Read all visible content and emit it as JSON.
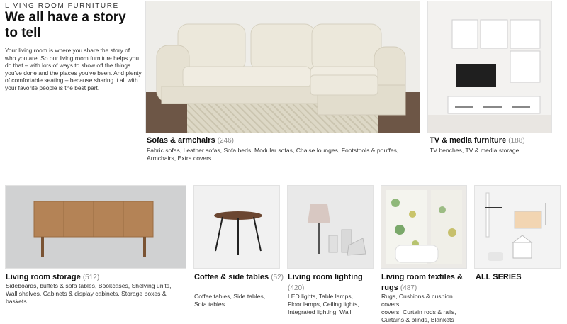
{
  "header": {
    "eyebrow": "LIVING ROOM FURNITURE",
    "headline": "We all have a story to tell",
    "intro": "Your living room is where you share the story of who you are. So our living room furniture helps you do that – with lots of ways to show off the things you've done and the places you've been. And plenty of comfortable seating – because sharing it all with your favorite people is the best part."
  },
  "categories": [
    {
      "title": "Sofas & armchairs",
      "count": "(246)",
      "links": [
        "Fabric sofas",
        "Leather sofas",
        "Sofa beds",
        "Modular sofas",
        "Chaise lounges",
        "Footstools & pouffes",
        "Armchairs",
        "Extra covers"
      ],
      "image_icon": "sofa-photo"
    },
    {
      "title": "TV & media furniture",
      "count": "(188)",
      "links": [
        "TV benches",
        "TV & media storage"
      ],
      "image_icon": "tv-unit-photo"
    },
    {
      "title": "Living room storage",
      "count": "(512)",
      "links": [
        "Sideboards, buffets & sofa tables",
        "Bookcases",
        "Shelving units",
        "Wall shelves",
        "Cabinets & display cabinets",
        "Storage boxes & baskets"
      ],
      "image_icon": "sideboard-photo"
    },
    {
      "title": "Coffee & side tables",
      "count": "(52)",
      "links": [
        "Coffee tables",
        "Side tables",
        "Sofa tables"
      ],
      "image_icon": "side-table-photo"
    },
    {
      "title": "Living room lighting",
      "count": "(420)",
      "links": [
        "LED lights",
        "Table lamps",
        "Floor lamps",
        "Ceiling lights",
        "Integrated lighting",
        "Wall"
      ],
      "image_icon": "lamps-photo"
    },
    {
      "title": "Living room textiles & rugs",
      "count": "(487)",
      "links": [
        "Rugs",
        "Cushions & cushion covers",
        "Curtain rods & rails",
        "Curtains & blinds",
        "Blankets"
      ],
      "image_icon": "textiles-photo"
    },
    {
      "title": "ALL SERIES",
      "count": "",
      "links": [],
      "image_icon": "series-photo"
    }
  ],
  "colors": {
    "text": "#111111",
    "muted_count": "#888888",
    "link": "#333333"
  }
}
